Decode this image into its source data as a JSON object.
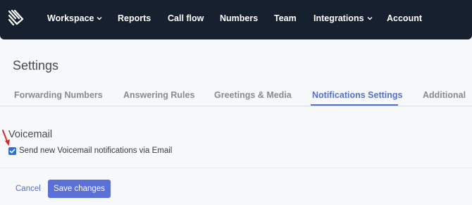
{
  "nav": {
    "items": [
      {
        "label": "Workspace",
        "has_dropdown": true
      },
      {
        "label": "Reports",
        "has_dropdown": false
      },
      {
        "label": "Call flow",
        "has_dropdown": false
      },
      {
        "label": "Numbers",
        "has_dropdown": false
      },
      {
        "label": "Team",
        "has_dropdown": false
      },
      {
        "label": "Integrations",
        "has_dropdown": true
      },
      {
        "label": "Account",
        "has_dropdown": false
      }
    ],
    "logo_icon": "brand-logo-icon",
    "dropdown_icon": "chevron-down-icon",
    "background_color": "#17202e"
  },
  "page": {
    "title": "Settings"
  },
  "tabs": [
    {
      "label": "Forwarding Numbers",
      "active": false
    },
    {
      "label": "Answering Rules",
      "active": false
    },
    {
      "label": "Greetings & Media",
      "active": false
    },
    {
      "label": "Notifications Settings",
      "active": true
    },
    {
      "label": "Additional",
      "active": false
    }
  ],
  "voicemail": {
    "section_title": "Voicemail",
    "checkbox_label": "Send new Voicemail notifications via Email",
    "checked": true,
    "annotation_icon": "red-arrow-icon"
  },
  "actions": {
    "cancel_label": "Cancel",
    "save_label": "Save changes"
  },
  "colors": {
    "accent": "#5570c8",
    "save_button": "#5b70d6",
    "annotation_arrow": "#d62b2b"
  }
}
